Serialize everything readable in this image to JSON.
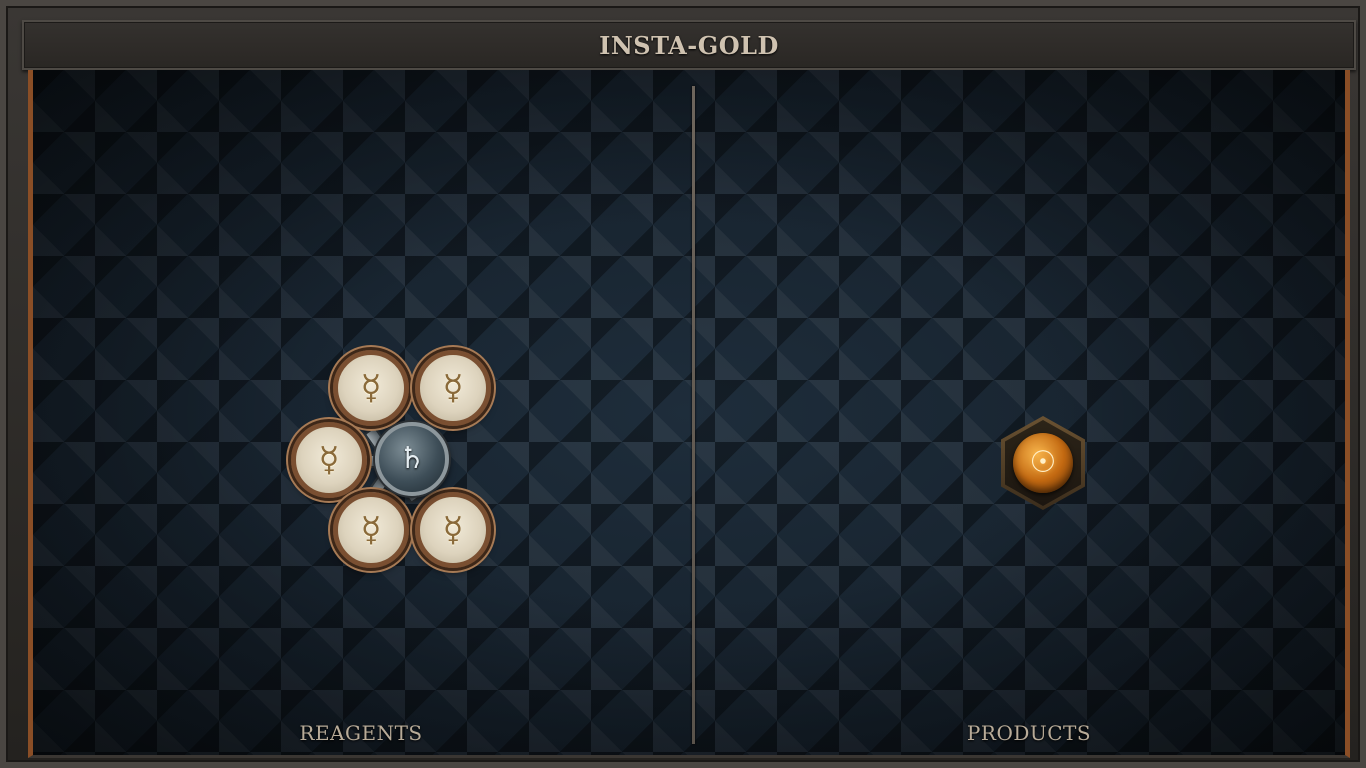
{
  "window": {
    "title": "INSTA-GOLD"
  },
  "reagents": {
    "label": "REAGENTS",
    "center_atom": {
      "element": "lead",
      "symbol": "♄"
    },
    "outer_atoms": [
      {
        "element": "mercury",
        "symbol": "☿"
      },
      {
        "element": "mercury",
        "symbol": "☿"
      },
      {
        "element": "mercury",
        "symbol": "☿"
      },
      {
        "element": "mercury",
        "symbol": "☿"
      },
      {
        "element": "mercury",
        "symbol": "☿"
      }
    ]
  },
  "products": {
    "label": "PRODUCTS",
    "atom": {
      "element": "gold",
      "symbol": "☉"
    }
  },
  "colors": {
    "board_background": "#16222e",
    "frame_accent": "#8a4e26",
    "label_text": "#b8ab98",
    "title_text": "#cfc2b0"
  }
}
